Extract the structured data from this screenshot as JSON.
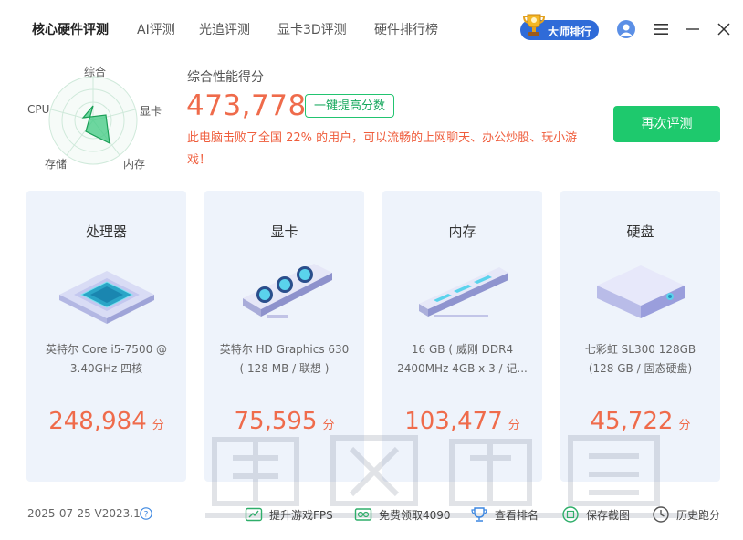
{
  "tabs": [
    "核心硬件评测",
    "AI评测",
    "光追评测",
    "显卡3D评测",
    "硬件排行榜"
  ],
  "master_rank": "大师排行",
  "radar_labels": {
    "top": "综合",
    "left": "CPU",
    "right": "显卡",
    "bottom_left": "存储",
    "bottom_right": "内存"
  },
  "summary": {
    "label": "综合性能得分",
    "score": "473,778",
    "boost_button": "一键提高分数",
    "description": "此电脑击败了全国 22% 的用户，可以流畅的上网聊天、办公炒股、玩小游戏！",
    "retest_button": "再次评测"
  },
  "cards": [
    {
      "title": "处理器",
      "line1": "英特尔 Core i5-7500 @",
      "line2": "3.40GHz 四核",
      "score": "248,984",
      "unit": "分"
    },
    {
      "title": "显卡",
      "line1": "英特尔 HD Graphics 630",
      "line2": "( 128 MB / 联想 )",
      "score": "75,595",
      "unit": "分"
    },
    {
      "title": "内存",
      "line1": "16 GB ( 威刚 DDR4",
      "line2": "2400MHz 4GB x 3 / 记...",
      "score": "103,477",
      "unit": "分"
    },
    {
      "title": "硬盘",
      "line1": "七彩虹 SL300 128GB",
      "line2": "(128 GB / 固态硬盘)",
      "score": "45,722",
      "unit": "分"
    }
  ],
  "footer": {
    "version": "2025-07-25 V2023.1",
    "items": [
      "提升游戏FPS",
      "免费领取4090",
      "查看排名",
      "保存截图",
      "历史跑分"
    ]
  },
  "colors": {
    "accent_green": "#1ec96d",
    "score_orange": "#ef6b4b",
    "card_bg": "#eef3fb",
    "master_blue": "#2f6bd8"
  }
}
